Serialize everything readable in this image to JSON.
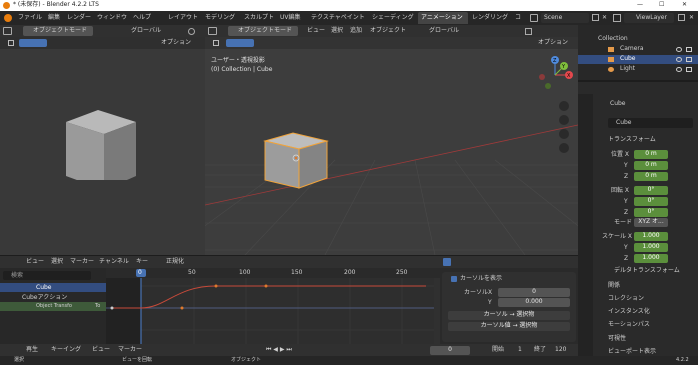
{
  "window": {
    "title": "* (未保存) - Blender 4.2.2 LTS",
    "min": "—",
    "max": "☐",
    "close": "✕"
  },
  "menu": [
    "ファイル",
    "編集",
    "レンダー",
    "ウィンドウ",
    "ヘルプ"
  ],
  "workspaces": [
    "レイアウト",
    "モデリング",
    "スカルプト",
    "UV編集",
    "テクスチャペイント",
    "シェーディング",
    "アニメーション",
    "レンダリング",
    "コ"
  ],
  "active_workspace": "アニメーション",
  "scene": {
    "label": "Scene",
    "viewlayer": "ViewLayer"
  },
  "left_viewport": {
    "mode": "オブジェクトモード",
    "transform": "グローバル",
    "options": "オプション"
  },
  "main_viewport": {
    "mode": "オブジェクトモード",
    "menu": [
      "ビュー",
      "選択",
      "追加",
      "オブジェクト"
    ],
    "transform": "グローバル",
    "options": "オプション",
    "view_title": "ユーザー・透視投影",
    "collection_info": "(0) Collection | Cube"
  },
  "gizmo": {
    "x": "X",
    "y": "Y",
    "z": "Z"
  },
  "outliner": {
    "collection": "Collection",
    "items": [
      "Camera",
      "Cube",
      "Light"
    ]
  },
  "properties": {
    "object_name": "Cube",
    "object_field": "Cube",
    "transform_header": "トランスフォーム",
    "location_label": "位置 X",
    "rotation_label": "回転 X",
    "scale_label": "スケール X",
    "location": [
      "0 m",
      "0 m",
      "0 m"
    ],
    "rotation": [
      "0°",
      "0°",
      "0°"
    ],
    "mode_label": "モード",
    "mode_value": "XYZ オ...",
    "scale": [
      "1.000",
      "1.000",
      "1.000"
    ],
    "axis_y": "Y",
    "axis_z": "Z",
    "sections": [
      "デルタトランスフォーム",
      "関係",
      "コレクション",
      "インスタンス化",
      "モーションパス",
      "可視性",
      "ビューポート表示"
    ]
  },
  "timeline_header": {
    "menu": [
      "ビュー",
      "選択",
      "マーカー",
      "チャンネル",
      "キー"
    ],
    "normalize": "正規化"
  },
  "channels": {
    "search_placeholder": "検索",
    "cube": "Cube",
    "action": "Cubeアクション",
    "transform": "Object Transfo",
    "to": "To"
  },
  "ruler": {
    "current": "0",
    "ticks": [
      "50",
      "100",
      "150",
      "200",
      "250"
    ]
  },
  "cursor_panel": {
    "header": "カーソルを表示",
    "cursor_x_label": "カーソルX",
    "cursor_x": "0",
    "y_label": "Y",
    "y_value": "0.000",
    "btn1": "カーソル → 選択物",
    "btn2": "カーソル値 → 選択物"
  },
  "playback": {
    "menu": [
      "再生",
      "キーイング",
      "ビュー",
      "マーカー"
    ],
    "frame": "0",
    "start_label": "開始",
    "start": "1",
    "end_label": "終了",
    "end": "120"
  },
  "statusbar": {
    "select": "選択",
    "rotate": "ビューを回転",
    "object": "オブジェクト",
    "version": "4.2.2"
  },
  "colors": {
    "accent": "#4772b3",
    "selected_orange": "#f0a33a",
    "green": "#5b8f3c"
  }
}
